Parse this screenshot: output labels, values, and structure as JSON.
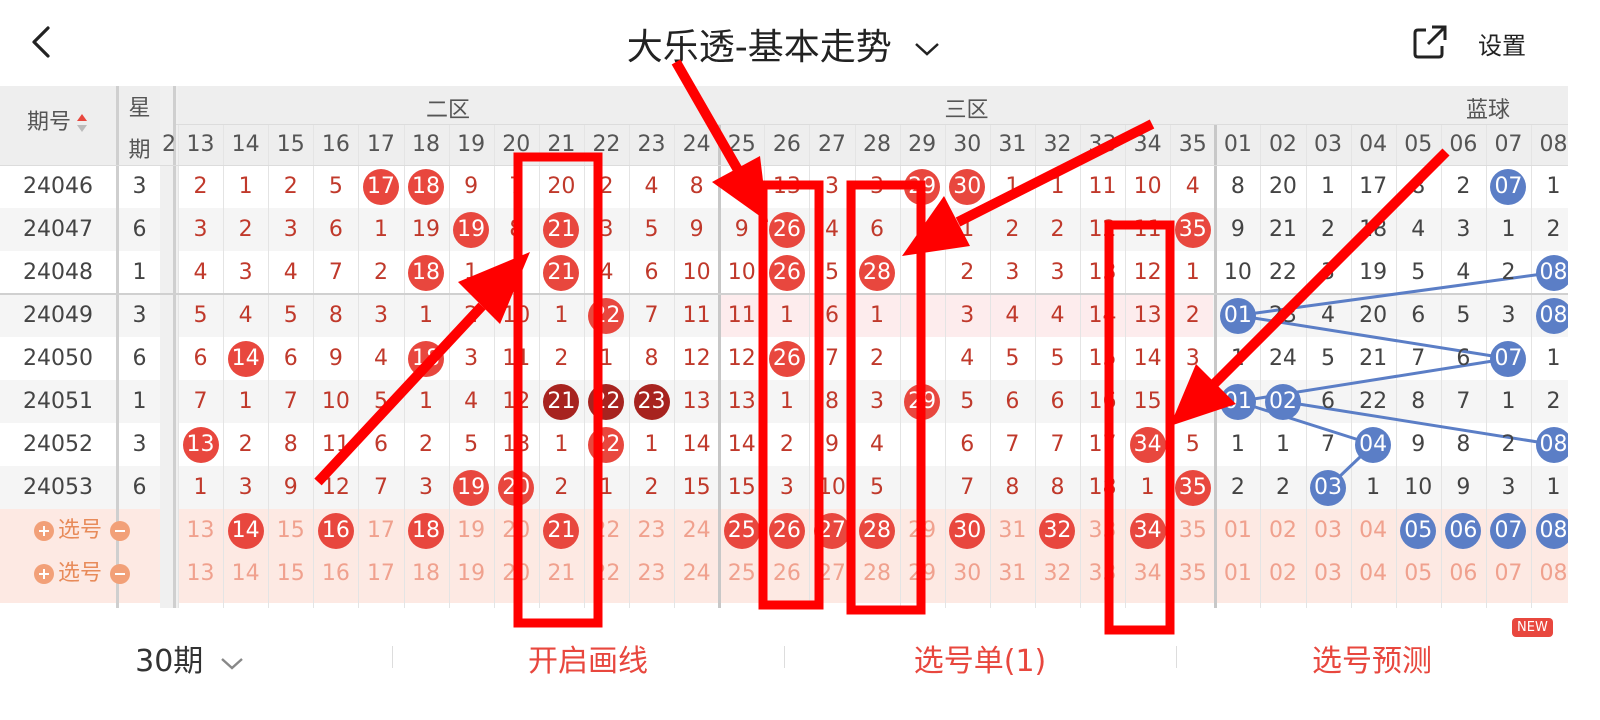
{
  "header": {
    "title": "大乐透-基本走势",
    "settings_label": "设置"
  },
  "grid": {
    "period_header": "期号",
    "weekday_header": [
      "星",
      "期"
    ],
    "zone_labels": [
      "二区",
      "三区",
      "蓝球"
    ],
    "partial_first_col": "2",
    "cols": [
      "13",
      "14",
      "15",
      "16",
      "17",
      "18",
      "19",
      "20",
      "21",
      "22",
      "23",
      "24",
      "25",
      "26",
      "27",
      "28",
      "29",
      "30",
      "31",
      "32",
      "33",
      "34",
      "35",
      "01",
      "02",
      "03",
      "04",
      "05",
      "06",
      "07",
      "08"
    ],
    "rows": [
      {
        "period": "24046",
        "weekday": "3",
        "cells": [
          "2",
          "1",
          "2",
          "5",
          "17",
          "18",
          "9",
          "7",
          "20",
          "2",
          "4",
          "8",
          "12",
          "13",
          "3",
          "3",
          "29",
          "30",
          "1",
          "1",
          "11",
          "10",
          "4",
          "8",
          "20",
          "1",
          "17",
          "8",
          "2",
          "07",
          "1"
        ]
      },
      {
        "period": "24047",
        "weekday": "6",
        "cells": [
          "3",
          "2",
          "3",
          "6",
          "1",
          "19",
          "19",
          "8",
          "21",
          "3",
          "5",
          "9",
          "9",
          "26",
          "4",
          "6",
          "",
          "1",
          "2",
          "2",
          "12",
          "11",
          "35",
          "9",
          "21",
          "2",
          "18",
          "4",
          "3",
          "1",
          "2"
        ]
      },
      {
        "period": "24048",
        "weekday": "1",
        "cells": [
          "4",
          "3",
          "4",
          "7",
          "2",
          "18",
          "1",
          "9",
          "21",
          "4",
          "6",
          "10",
          "10",
          "26",
          "5",
          "28",
          "",
          "2",
          "3",
          "3",
          "13",
          "12",
          "1",
          "10",
          "22",
          "3",
          "19",
          "5",
          "4",
          "2",
          "08"
        ]
      },
      {
        "period": "24049",
        "weekday": "3",
        "cells": [
          "5",
          "4",
          "5",
          "8",
          "3",
          "1",
          "2",
          "10",
          "1",
          "22",
          "7",
          "11",
          "11",
          "1",
          "6",
          "1",
          "",
          "3",
          "4",
          "4",
          "14",
          "13",
          "2",
          "01",
          "23",
          "4",
          "20",
          "6",
          "5",
          "3",
          "08"
        ]
      },
      {
        "period": "24050",
        "weekday": "6",
        "cells": [
          "6",
          "14",
          "6",
          "9",
          "4",
          "18",
          "3",
          "11",
          "2",
          "1",
          "8",
          "12",
          "12",
          "26",
          "7",
          "2",
          "",
          "4",
          "5",
          "5",
          "15",
          "14",
          "3",
          "1",
          "24",
          "5",
          "21",
          "7",
          "6",
          "07",
          "1"
        ]
      },
      {
        "period": "24051",
        "weekday": "1",
        "cells": [
          "7",
          "1",
          "7",
          "10",
          "5",
          "1",
          "4",
          "12",
          "21",
          "22",
          "23",
          "13",
          "13",
          "1",
          "8",
          "3",
          "29",
          "5",
          "6",
          "6",
          "16",
          "15",
          "4",
          "01",
          "02",
          "6",
          "22",
          "8",
          "7",
          "1",
          "2"
        ]
      },
      {
        "period": "24052",
        "weekday": "3",
        "cells": [
          "13",
          "2",
          "8",
          "11",
          "6",
          "2",
          "5",
          "13",
          "1",
          "22",
          "1",
          "14",
          "14",
          "2",
          "9",
          "4",
          "",
          "6",
          "7",
          "7",
          "17",
          "34",
          "5",
          "1",
          "1",
          "7",
          "04",
          "9",
          "8",
          "2",
          "08"
        ]
      },
      {
        "period": "24053",
        "weekday": "6",
        "cells": [
          "1",
          "3",
          "9",
          "12",
          "7",
          "3",
          "19",
          "20",
          "2",
          "1",
          "2",
          "15",
          "15",
          "3",
          "10",
          "5",
          "",
          "7",
          "8",
          "8",
          "18",
          "1",
          "35",
          "2",
          "2",
          "03",
          "1",
          "10",
          "9",
          "3",
          "1"
        ]
      }
    ],
    "selection_label": "选号",
    "selection_rows": [
      [
        "13",
        "14",
        "15",
        "16",
        "17",
        "18",
        "19",
        "20",
        "21",
        "22",
        "23",
        "24",
        "25",
        "26",
        "27",
        "28",
        "29",
        "30",
        "31",
        "32",
        "33",
        "34",
        "35",
        "01",
        "02",
        "03",
        "04",
        "05",
        "06",
        "07",
        "08"
      ],
      [
        "13",
        "14",
        "15",
        "16",
        "17",
        "18",
        "19",
        "20",
        "21",
        "22",
        "23",
        "24",
        "25",
        "26",
        "27",
        "28",
        "29",
        "30",
        "31",
        "32",
        "33",
        "34",
        "35",
        "01",
        "02",
        "03",
        "04",
        "05",
        "06",
        "07",
        "08"
      ]
    ]
  },
  "bottom": {
    "periods": "30期",
    "draw_lines": "开启画线",
    "pick_list": "选号单(1)",
    "prediction": "选号预测",
    "new_badge": "NEW"
  },
  "colors": {
    "red": "#e8473e",
    "dark_red": "#a7231f",
    "blue": "#5b7ec6",
    "annotation": "#ff0000",
    "text_red": "#c0392b"
  }
}
